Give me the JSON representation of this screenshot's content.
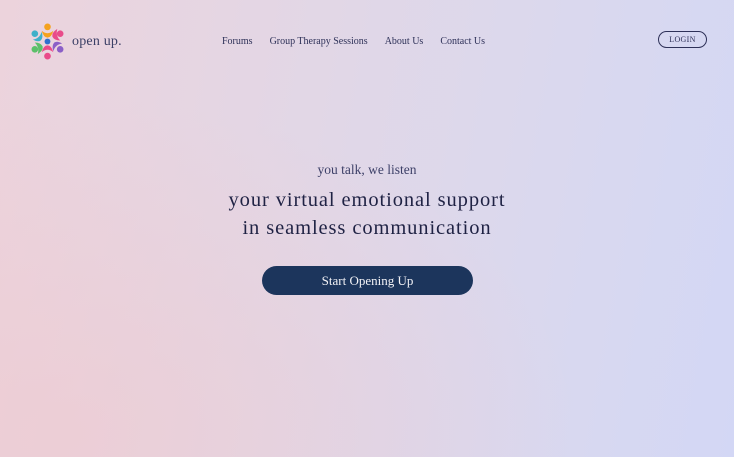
{
  "brand": {
    "name": "open up.",
    "logo_icon": "colorful-people-circle-logo",
    "logo_colors": [
      "#3fb0c9",
      "#f4a21f",
      "#e94b8a",
      "#8b5fc7",
      "#5cc06a",
      "#2f6fcf"
    ]
  },
  "nav": {
    "items": [
      {
        "label": "Forums"
      },
      {
        "label": "Group Therapy Sessions"
      },
      {
        "label": "About Us"
      },
      {
        "label": "Contact Us"
      }
    ]
  },
  "header": {
    "login_label": "LOGIN"
  },
  "hero": {
    "tagline": "you talk, we listen",
    "headline_line1": "your virtual emotional support",
    "headline_line2": "in seamless communication",
    "cta_label": "Start Opening Up"
  },
  "colors": {
    "cta_background": "#1c355c",
    "text_dark": "#1f2244"
  }
}
